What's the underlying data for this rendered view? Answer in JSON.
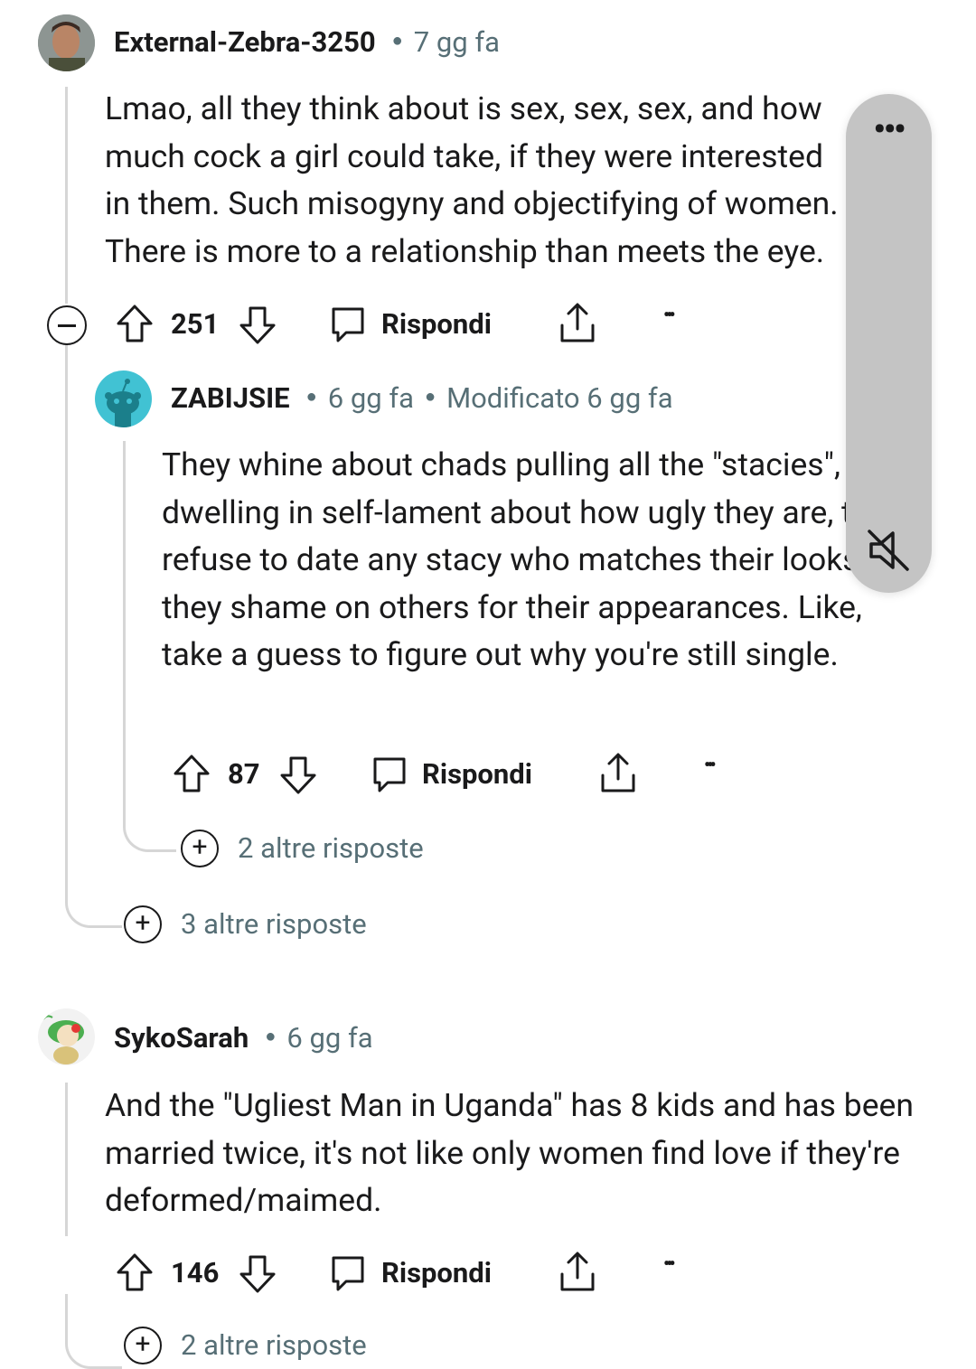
{
  "comments": [
    {
      "author": "External-Zebra-3250",
      "time": "7 gg fa",
      "text": "Lmao, all they think about is sex, sex, sex, and how much cock a girl could take, if they were interested in them. Such misogyny and objectifying of women. There is more to a relationship than meets the eye.",
      "score": "251",
      "reply_label": "Rispondi",
      "more_label": "•••",
      "more_replies": "3 altre risposte",
      "collapse_symbol": "−",
      "reply": {
        "author": "ZABIJSIE",
        "time": "6 gg fa",
        "edited": "Modificato 6 gg fa",
        "text": "They whine about chads pulling all the \"stacies\", dwelling in self-lament about how ugly they are, then refuse to date any stacy who matches their looks, or they shame on others for their appearances. Like, take a guess to figure out why you're still single.",
        "score": "87",
        "reply_label": "Rispondi",
        "more_label": "•••",
        "more_replies": "2 altre risposte"
      }
    },
    {
      "author": "SykoSarah",
      "time": "6 gg fa",
      "text": "And the \"Ugliest Man in Uganda\" has 8 kids and has been married twice, it's not like only women find love if they're deformed/maimed.",
      "score": "146",
      "reply_label": "Rispondi",
      "more_label": "•••",
      "more_replies": "2 altre risposte"
    }
  ],
  "overlay": {
    "menu_label": "•••",
    "icon": "speaker-muted-icon"
  },
  "plus_symbol": "+",
  "icons": [
    "avatar",
    "upvote-icon",
    "downvote-icon",
    "comment-icon",
    "share-icon",
    "more-icon",
    "collapse-icon",
    "expand-icon",
    "speaker-muted-icon"
  ]
}
